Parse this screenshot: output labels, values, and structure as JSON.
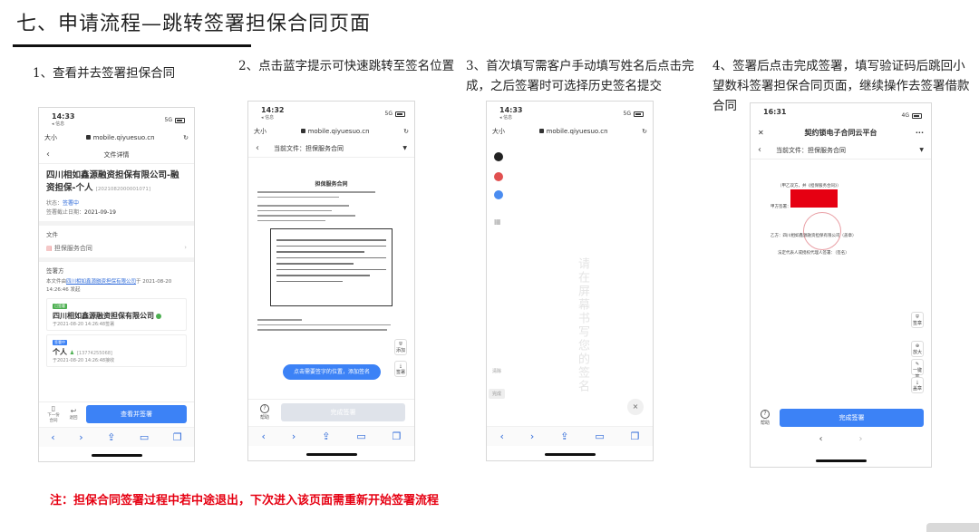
{
  "slide": {
    "title": "七、申请流程—跳转签署担保合同页面",
    "footer_note": "注：担保合同签署过程中若中途退出，下次进入该页面需重新开始签署流程"
  },
  "steps": [
    {
      "caption": "1、查看并去签署担保合同"
    },
    {
      "caption": "2、点击蓝字提示可快速跳转至签名位置"
    },
    {
      "caption": "3、首次填写需客户手动填写姓名后点击完成，之后签署时可选择历史签名提交"
    },
    {
      "caption": "4、签署后点击完成签署，填写验证码后跳回小望数科签署担保合同页面，继续操作去签署借款合同"
    }
  ],
  "browser": {
    "domain": "mobile.qiyuesuo.cn",
    "text_size": "大小",
    "back_app": "◂ 信息"
  },
  "colors": {
    "accent": "#3c82f6",
    "note_red": "#e60012"
  },
  "phone1": {
    "time": "14:33",
    "signal": "5G",
    "nav_title": "文件详情",
    "company": "四川相如鑫源融资担保有限公司-融资担保-个人",
    "code": "[2021082000001071]",
    "status_label": "状态：",
    "status_value": "签署中",
    "deadline_label": "签署截止日期：",
    "deadline_value": "2021-09-19",
    "section_file": "文件",
    "doc_name": "担保服务合同",
    "section_signers": "签署方",
    "desc_prefix": "本文件由",
    "desc_company": "四川相如鑫源融资担保有限公司",
    "desc_suffix": "于 2021-08-20 14:26:46 发起",
    "signer1_tag": "已签署",
    "signer1_name": "四川相如鑫源融资担保有限公司",
    "signer1_time": "于2021-08-20 14:26:48签署",
    "signer2_tag": "签署中",
    "signer2_name": "个人",
    "signer2_phone": "[13774255068]",
    "signer2_time": "于2021-08-20 14:26:48接收",
    "action_next": "下一份合同",
    "action_back": "退回",
    "main_button": "查看并签署"
  },
  "phone2": {
    "time": "14:32",
    "signal": "5G",
    "current_file": "当前文件：担保服务合同",
    "doc_title": "担保服务合同",
    "hint": "点击需要签字的位置，添加签名",
    "tool1": "添加",
    "tool2": "签署",
    "help": "帮助",
    "finish": "完成签署"
  },
  "phone3": {
    "time": "14:33",
    "signal": "5G",
    "vertical_hint": "请在屏幕书写您的签名",
    "side_label1": "清除",
    "side_label2": "完成",
    "close": "×",
    "colors": [
      "#222222",
      "#e15050",
      "#4a8cf0"
    ]
  },
  "phone4": {
    "time": "16:31",
    "signal": "4G",
    "nav_title": "契约锁电子合同云平台",
    "current_file": "当前文件：担保服务合同",
    "line1": "（甲乙双方，并《担保服务合同》）",
    "line2": "甲方签署：",
    "line3": "乙方：四川相如鑫源融资担保有限公司（盖章）",
    "line4": "法定代表人或授权代理人签署：（签名）",
    "tool1": "签章",
    "tool2": "放大",
    "tool3": "一键签",
    "tool4": "盖章",
    "help": "帮助",
    "finish": "完成签署"
  }
}
